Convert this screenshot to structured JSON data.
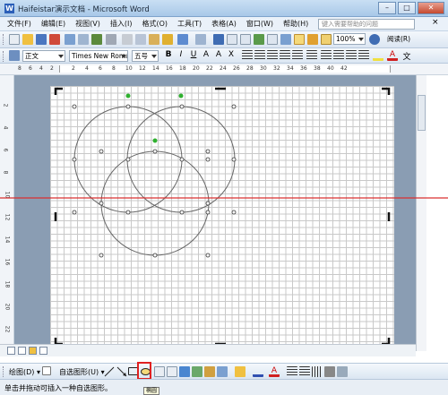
{
  "window": {
    "title": "Haifeistar演示文档 - Microsoft Word",
    "app_icon": "W"
  },
  "menu": {
    "items": [
      "文件(F)",
      "编辑(E)",
      "视图(V)",
      "插入(I)",
      "格式(O)",
      "工具(T)",
      "表格(A)",
      "窗口(W)",
      "帮助(H)"
    ],
    "help_placeholder": "键入需要帮助的问题",
    "close_glyph": "×"
  },
  "toolbar": {
    "zoom": "100%",
    "read_label": "阅读(R)"
  },
  "format": {
    "style": "正文",
    "font": "Times New Roma",
    "size": "五号"
  },
  "ruler": {
    "h_ticks": [
      "8",
      "6",
      "4",
      "2",
      "2",
      "4",
      "6",
      "8",
      "10",
      "12",
      "14",
      "16",
      "18",
      "20",
      "22",
      "24",
      "26",
      "28",
      "30",
      "32",
      "34",
      "36",
      "38",
      "40",
      "42"
    ],
    "v_ticks": [
      "2",
      "4",
      "6",
      "8",
      "10",
      "12",
      "14",
      "16",
      "18",
      "20",
      "22"
    ]
  },
  "drawbar": {
    "draw_label": "绘图(D) ▾",
    "autoshape_label": "自选图形(U) ▾"
  },
  "status": {
    "text": "单击并拖动可插入一种自选图形。",
    "tooltip": "椭圆"
  },
  "colors": {
    "accent_line": "#d93030",
    "selection": "#e02020",
    "handle_green": "#2fb02f"
  }
}
